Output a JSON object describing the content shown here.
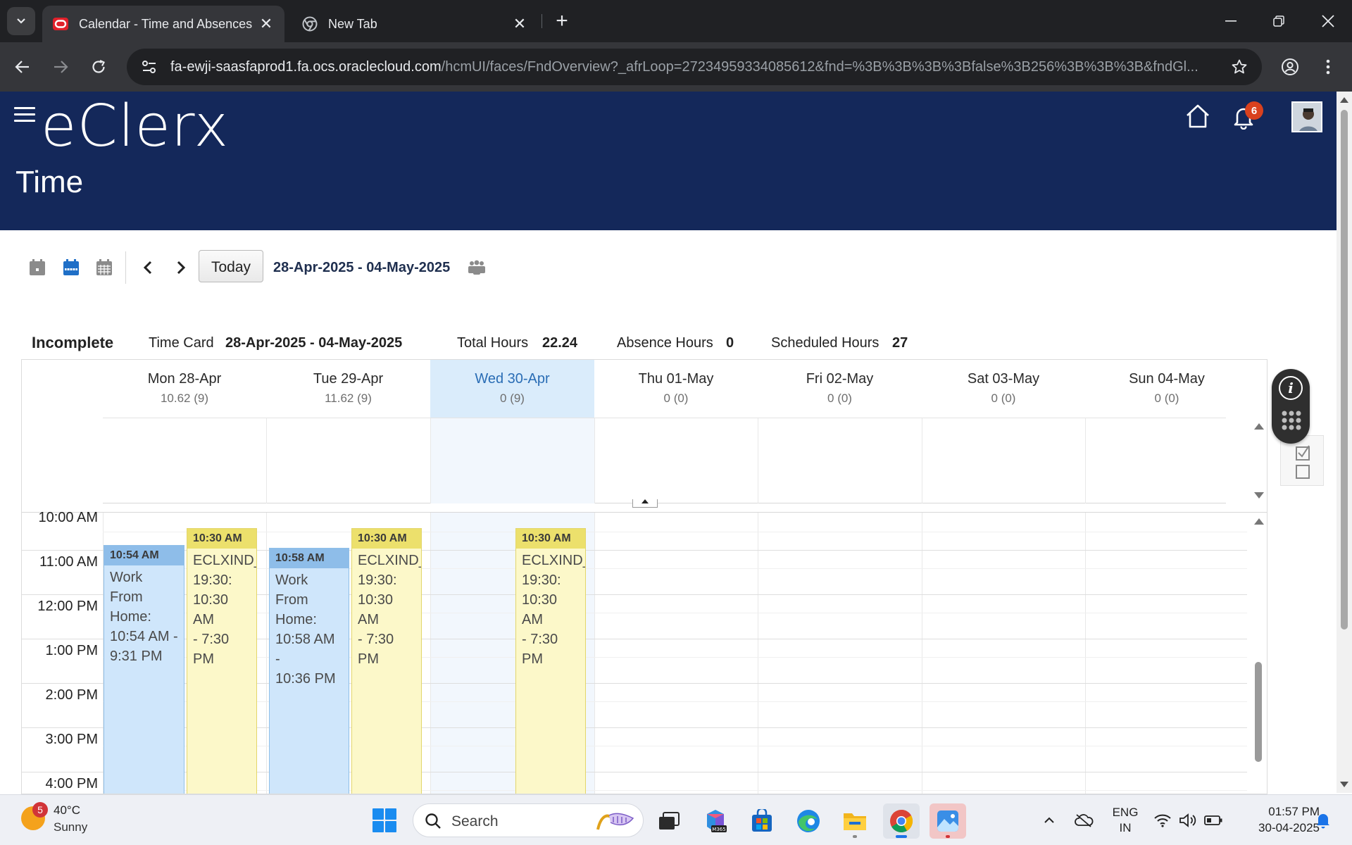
{
  "browser": {
    "tabs": [
      {
        "title": "Calendar - Time and Absences",
        "active": true
      },
      {
        "title": "New Tab",
        "active": false
      }
    ],
    "url_host": "fa-ewji-saasfaprod1.fa.ocs.oraclecloud.com",
    "url_path": "/hcmUI/faces/FndOverview?_afrLoop=27234959334085612&fnd=%3B%3B%3B%3Bfalse%3B256%3B%3B%3B&fndGl..."
  },
  "app": {
    "brand": "eClerx",
    "page_title": "Time",
    "notification_count": "6"
  },
  "calendar": {
    "today_label": "Today",
    "date_range": "28-Apr-2025 - 04-May-2025",
    "summary": {
      "status": "Incomplete",
      "time_card_label": "Time Card",
      "time_card_value": "28-Apr-2025 - 04-May-2025",
      "total_hours_label": "Total Hours",
      "total_hours_value": "22.24",
      "absence_hours_label": "Absence Hours",
      "absence_hours_value": "0",
      "scheduled_hours_label": "Scheduled Hours",
      "scheduled_hours_value": "27"
    },
    "days": [
      {
        "name": "Mon 28-Apr",
        "hours": "10.62 (9)"
      },
      {
        "name": "Tue 29-Apr",
        "hours": "11.62 (9)"
      },
      {
        "name": "Wed 30-Apr",
        "hours": "0 (9)",
        "today": true
      },
      {
        "name": "Thu 01-May",
        "hours": "0 (0)"
      },
      {
        "name": "Fri 02-May",
        "hours": "0 (0)"
      },
      {
        "name": "Sat 03-May",
        "hours": "0 (0)"
      },
      {
        "name": "Sun 04-May",
        "hours": "0 (0)"
      }
    ],
    "time_labels": [
      "10:00 AM",
      "11:00 AM",
      "12:00 PM",
      "1:00 PM",
      "2:00 PM",
      "3:00 PM",
      "4:00 PM"
    ],
    "events": [
      {
        "day": 0,
        "kind": "wfh",
        "time": "10:54 AM",
        "lines": [
          "Work From",
          "Home:",
          "10:54 AM -",
          "9:31 PM"
        ]
      },
      {
        "day": 0,
        "kind": "shift",
        "time": "10:30 AM",
        "lines": [
          "ECLXIND_",
          "19:30:",
          "10:30 AM",
          "- 7:30 PM"
        ]
      },
      {
        "day": 1,
        "kind": "wfh",
        "time": "10:58 AM",
        "lines": [
          "Work From",
          "Home:",
          "10:58 AM -",
          "10:36 PM"
        ]
      },
      {
        "day": 1,
        "kind": "shift",
        "time": "10:30 AM",
        "lines": [
          "ECLXIND_",
          "19:30:",
          "10:30 AM",
          "- 7:30 PM"
        ]
      },
      {
        "day": 2,
        "kind": "shift",
        "time": "10:30 AM",
        "lines": [
          "ECLXIND_",
          "19:30:",
          "10:30 AM",
          "- 7:30 PM"
        ]
      }
    ],
    "colors": {
      "header_bg": "#14285a",
      "today_col": "#daecfb",
      "wfh": "#cfe6fb",
      "shift": "#fcf8c9"
    }
  },
  "taskbar": {
    "weather_temp": "40°C",
    "weather_desc": "Sunny",
    "weather_badge": "5",
    "search_placeholder": "Search",
    "lang_line1": "ENG",
    "lang_line2": "IN",
    "time": "01:57 PM",
    "date": "30-04-2025"
  }
}
